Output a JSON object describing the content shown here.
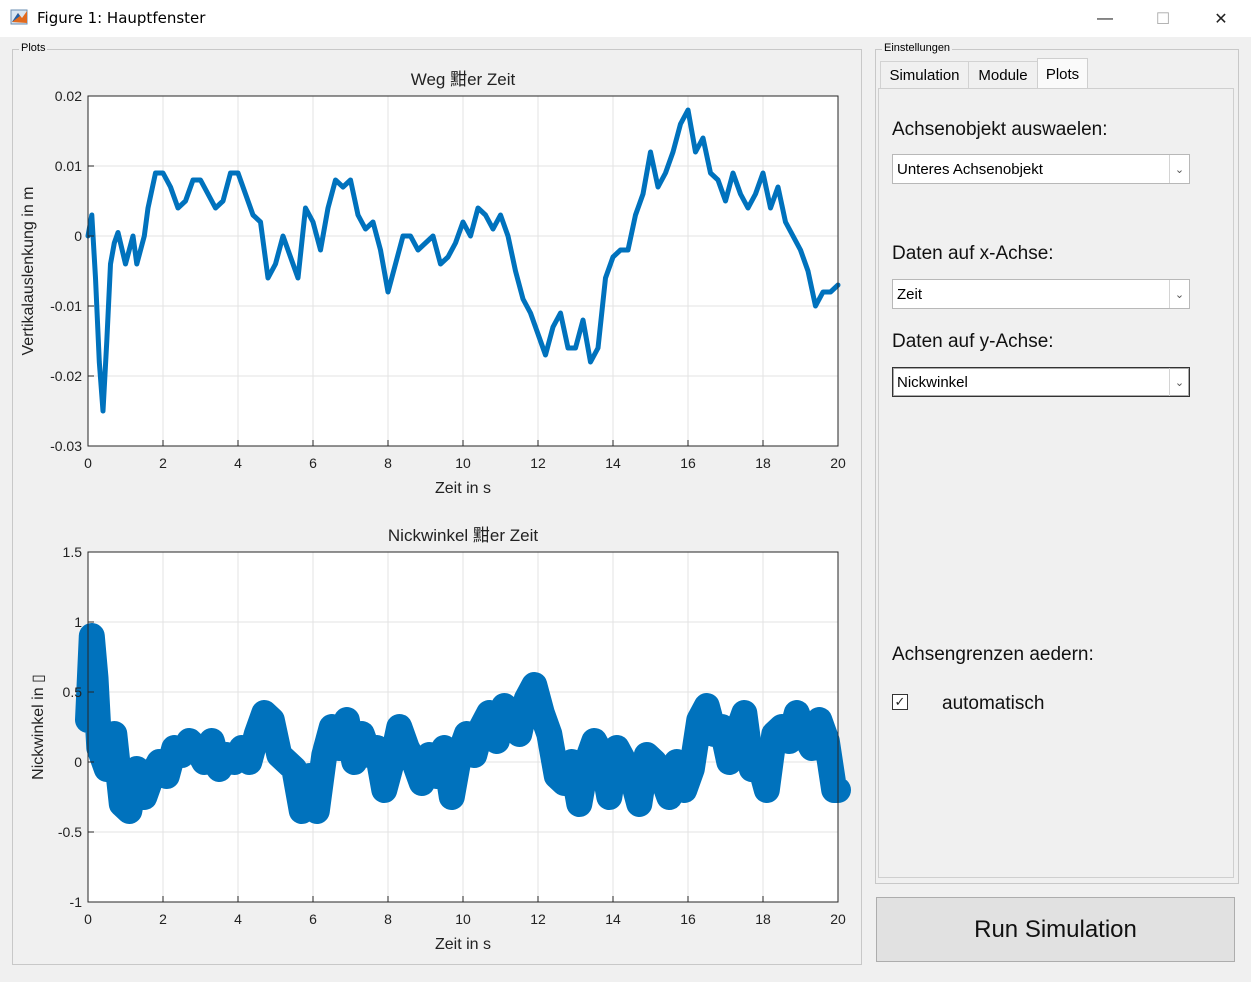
{
  "window": {
    "title": "Figure 1: Hauptfenster",
    "minimize_glyph": "—",
    "maximize_glyph": "☐",
    "close_glyph": "✕"
  },
  "plots_panel": {
    "label": "Plots"
  },
  "settings_panel": {
    "label": "Einstellungen",
    "tabs": [
      {
        "label": "Simulation",
        "active": false
      },
      {
        "label": "Module",
        "active": false
      },
      {
        "label": "Plots",
        "active": true
      }
    ],
    "axes_object_label": "Achsenobjekt auswaelen:",
    "axes_object_value": "Unteres Achsenobjekt",
    "x_data_label": "Daten auf x-Achse:",
    "x_data_value": "Zeit",
    "y_data_label": "Daten auf y-Achse:",
    "y_data_value": "Nickwinkel",
    "limits_label": "Achsengrenzen aedern:",
    "auto_label": "automatisch",
    "auto_checked": true
  },
  "run_button": {
    "label": "Run Simulation"
  },
  "icons": {
    "app": "matlab-icon",
    "dropdown": "chevron-down-icon",
    "check": "checkmark-icon"
  },
  "colors": {
    "line": "#0072bd",
    "grid": "#e3e3e3",
    "axes_bg": "#ffffff"
  },
  "chart_data": [
    {
      "type": "line",
      "title": "Weg 黚er Zeit",
      "xlabel": "Zeit in s",
      "ylabel": "Vertikalauslenkung in m",
      "xlim": [
        0,
        20
      ],
      "ylim": [
        -0.03,
        0.02
      ],
      "xticks": [
        0,
        2,
        4,
        6,
        8,
        10,
        12,
        14,
        16,
        18,
        20
      ],
      "yticks": [
        -0.03,
        -0.02,
        -0.01,
        0,
        0.01,
        0.02
      ],
      "ytick_labels": [
        "-0.03",
        "-0.02",
        "-0.01",
        "0",
        "0.01",
        "0.02"
      ],
      "grid": true,
      "series": [
        {
          "x": [
            0,
            0.1,
            0.2,
            0.3,
            0.4,
            0.5,
            0.6,
            0.7,
            0.8,
            1.0,
            1.2,
            1.3,
            1.5,
            1.6,
            1.8,
            2.0,
            2.2,
            2.4,
            2.6,
            2.8,
            3.0,
            3.2,
            3.4,
            3.6,
            3.8,
            4.0,
            4.2,
            4.4,
            4.6,
            4.8,
            5.0,
            5.2,
            5.4,
            5.6,
            5.8,
            6.0,
            6.2,
            6.4,
            6.6,
            6.8,
            7.0,
            7.2,
            7.4,
            7.6,
            7.8,
            8.0,
            8.2,
            8.4,
            8.6,
            8.8,
            9.0,
            9.2,
            9.4,
            9.6,
            9.8,
            10.0,
            10.2,
            10.4,
            10.6,
            10.8,
            11.0,
            11.2,
            11.4,
            11.6,
            11.8,
            12.0,
            12.2,
            12.4,
            12.6,
            12.8,
            13.0,
            13.2,
            13.4,
            13.6,
            13.8,
            14.0,
            14.2,
            14.4,
            14.6,
            14.8,
            15.0,
            15.2,
            15.4,
            15.6,
            15.8,
            16.0,
            16.2,
            16.4,
            16.6,
            16.8,
            17.0,
            17.2,
            17.4,
            17.6,
            17.8,
            18.0,
            18.2,
            18.4,
            18.6,
            18.8,
            19.0,
            19.2,
            19.4,
            19.6,
            19.8,
            20.0
          ],
          "y": [
            0,
            0.003,
            -0.006,
            -0.018,
            -0.025,
            -0.015,
            -0.004,
            -0.001,
            0.0005,
            -0.004,
            0.0,
            -0.004,
            0.0,
            0.004,
            0.009,
            0.009,
            0.007,
            0.004,
            0.005,
            0.008,
            0.008,
            0.006,
            0.004,
            0.005,
            0.009,
            0.009,
            0.006,
            0.003,
            0.002,
            -0.006,
            -0.004,
            0.0,
            -0.003,
            -0.006,
            0.004,
            0.002,
            -0.002,
            0.004,
            0.008,
            0.007,
            0.008,
            0.003,
            0.001,
            0.002,
            -0.002,
            -0.008,
            -0.004,
            0.0,
            0.0,
            -0.002,
            -0.001,
            0.0,
            -0.004,
            -0.003,
            -0.001,
            0.002,
            0.0,
            0.004,
            0.003,
            0.001,
            0.003,
            0.0,
            -0.005,
            -0.009,
            -0.011,
            -0.014,
            -0.017,
            -0.013,
            -0.011,
            -0.016,
            -0.016,
            -0.012,
            -0.018,
            -0.016,
            -0.006,
            -0.003,
            -0.002,
            -0.002,
            0.003,
            0.006,
            0.012,
            0.007,
            0.009,
            0.012,
            0.016,
            0.018,
            0.012,
            0.014,
            0.009,
            0.008,
            0.005,
            0.009,
            0.006,
            0.004,
            0.006,
            0.009,
            0.004,
            0.007,
            0.002,
            0.0,
            -0.002,
            -0.005,
            -0.01,
            -0.008,
            -0.008,
            -0.007
          ]
        }
      ]
    },
    {
      "type": "line",
      "title": "Nickwinkel 黚er Zeit",
      "xlabel": "Zeit in s",
      "ylabel": "Nickwinkel in ▯",
      "xlim": [
        0,
        20
      ],
      "ylim": [
        -1,
        1.5
      ],
      "xticks": [
        0,
        2,
        4,
        6,
        8,
        10,
        12,
        14,
        16,
        18,
        20
      ],
      "yticks": [
        -1,
        -0.5,
        0,
        0.5,
        1,
        1.5
      ],
      "ytick_labels": [
        "-1",
        "-0.5",
        "0",
        "0.5",
        "1",
        "1.5"
      ],
      "grid": true,
      "series": [
        {
          "x": [
            0,
            0.1,
            0.2,
            0.3,
            0.5,
            0.7,
            0.9,
            1.1,
            1.3,
            1.5,
            1.7,
            1.9,
            2.1,
            2.3,
            2.5,
            2.7,
            2.9,
            3.1,
            3.3,
            3.5,
            3.7,
            3.9,
            4.1,
            4.3,
            4.5,
            4.7,
            4.9,
            5.1,
            5.3,
            5.5,
            5.7,
            5.9,
            6.1,
            6.3,
            6.5,
            6.7,
            6.9,
            7.1,
            7.3,
            7.5,
            7.7,
            7.9,
            8.1,
            8.3,
            8.5,
            8.7,
            8.9,
            9.1,
            9.3,
            9.5,
            9.7,
            9.9,
            10.1,
            10.3,
            10.5,
            10.7,
            10.9,
            11.1,
            11.3,
            11.5,
            11.7,
            11.9,
            12.1,
            12.3,
            12.5,
            12.7,
            12.9,
            13.1,
            13.3,
            13.5,
            13.7,
            13.9,
            14.1,
            14.3,
            14.5,
            14.7,
            14.9,
            15.1,
            15.3,
            15.5,
            15.7,
            15.9,
            16.1,
            16.3,
            16.5,
            16.7,
            16.9,
            17.1,
            17.3,
            17.5,
            17.7,
            17.9,
            18.1,
            18.3,
            18.5,
            18.7,
            18.9,
            19.1,
            19.3,
            19.5,
            19.7,
            19.9,
            20.0
          ],
          "y": [
            0.3,
            0.9,
            0.6,
            0.1,
            -0.05,
            0.2,
            -0.3,
            -0.35,
            -0.05,
            -0.25,
            -0.1,
            0.0,
            -0.1,
            0.1,
            0.05,
            0.15,
            0.1,
            0.0,
            0.15,
            -0.05,
            0.05,
            0.0,
            0.1,
            0.0,
            0.2,
            0.35,
            0.3,
            0.05,
            0.0,
            -0.05,
            -0.35,
            -0.1,
            -0.35,
            0.05,
            0.25,
            0.1,
            0.3,
            0.0,
            0.2,
            0.05,
            0.1,
            -0.2,
            0.0,
            0.25,
            0.1,
            0.0,
            -0.15,
            0.05,
            -0.1,
            0.1,
            -0.25,
            0.05,
            0.2,
            0.05,
            0.25,
            0.35,
            0.15,
            0.4,
            0.25,
            0.2,
            0.45,
            0.55,
            0.35,
            0.2,
            -0.1,
            -0.15,
            0.0,
            -0.3,
            0.0,
            0.15,
            0.05,
            -0.25,
            0.1,
            0.0,
            -0.1,
            -0.3,
            0.05,
            0.0,
            -0.1,
            -0.25,
            0.0,
            -0.2,
            -0.05,
            0.3,
            0.4,
            0.2,
            0.25,
            0.0,
            0.2,
            0.35,
            -0.05,
            0.0,
            -0.2,
            0.2,
            0.25,
            0.15,
            0.35,
            0.2,
            0.1,
            0.3,
            0.15,
            -0.2,
            -0.2
          ]
        }
      ]
    }
  ]
}
